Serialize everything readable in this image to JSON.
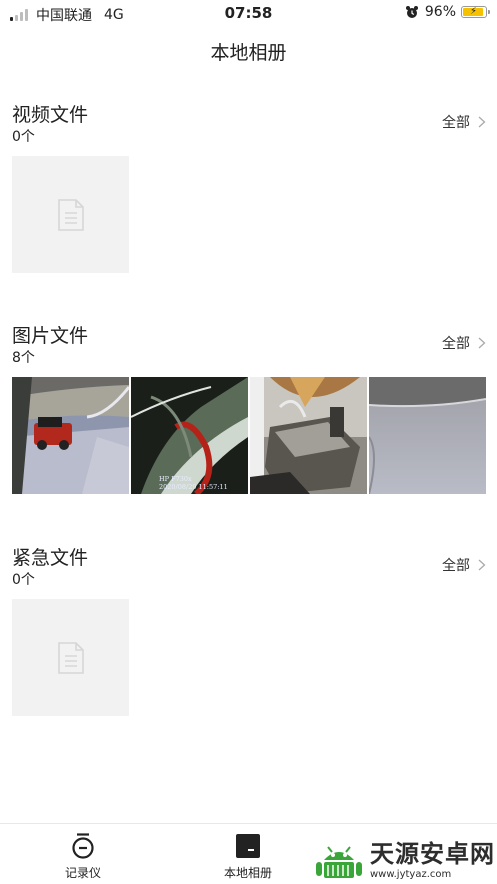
{
  "status_bar": {
    "carrier": "中国联通",
    "network": "4G",
    "time": "07:58",
    "battery": "96%"
  },
  "header": {
    "title": "本地相册"
  },
  "sections": [
    {
      "title": "视频文件",
      "count": "0个",
      "all_label": "全部"
    },
    {
      "title": "图片文件",
      "count": "8个",
      "all_label": "全部",
      "photo_overlay": [
        "HP F730x",
        "2020/08/29  11:57:11"
      ]
    },
    {
      "title": "紧急文件",
      "count": "0个",
      "all_label": "全部"
    }
  ],
  "tabbar": {
    "tabs": [
      {
        "label": "记录仪",
        "icon": "recorder-icon"
      },
      {
        "label": "本地相册",
        "icon": "album-icon"
      }
    ]
  },
  "watermark": {
    "title": "天源安卓网",
    "url": "www.jytyaz.com"
  },
  "colors": {
    "placeholder_bg": "#f2f2f2",
    "battery": "#f6c200",
    "watermark_green": "#3aa63a"
  }
}
